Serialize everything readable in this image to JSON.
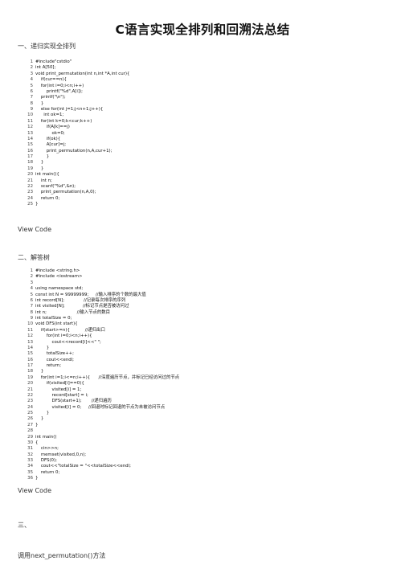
{
  "page": {
    "title": "C语言实现全排列和回溯法总结"
  },
  "sections": [
    {
      "heading": "一、递归实现全排列"
    },
    {
      "heading": "二、解答树"
    },
    {
      "heading": "三、"
    }
  ],
  "view_code_label": "View Code",
  "method_line": "调用next_permutation()方法",
  "code1": {
    "line_numbers": [
      "1",
      "2",
      "3",
      "4",
      "5",
      "6",
      "7",
      "8",
      "9",
      "10",
      "11",
      "12",
      "13",
      "14",
      "15",
      "16",
      "17",
      "18",
      "19",
      "20",
      "21",
      "22",
      "23",
      "24",
      "25"
    ],
    "lines": [
      "#include\"cstdio\"",
      "int A[50];",
      "void print_permutation(int n,int *A,int cur){",
      "    if(cur==n){",
      "    for(int i=0;i<n;i++)",
      "        printf(\"%d\",A[i]);",
      "    printf(\"\\n\");",
      "    }",
      "    else for(int j=1;j<n+1;j++){",
      "      int ok=1;",
      "    for(int k=0;k<cur;k++)",
      "        if(A[k]==j)",
      "            ok=0;",
      "        if(ok){",
      "        A[cur]=j;",
      "        print_permutation(n,A,cur+1);",
      "        }",
      "    }",
      "    }",
      "int main(){",
      "    int n;",
      "    scanf(\"%d\",&n);",
      "    print_permutation(n,A,0);",
      "    return 0;",
      "}"
    ]
  },
  "code2": {
    "line_numbers": [
      "1",
      "2",
      "3",
      "4",
      "5",
      "6",
      "7",
      "8",
      "9",
      "10",
      "11",
      "12",
      "13",
      "14",
      "15",
      "16",
      "17",
      "18",
      "19",
      "20",
      "21",
      "22",
      "23",
      "24",
      "25",
      "26",
      "27",
      "28",
      "29",
      "30",
      "31",
      "32",
      "33",
      "34",
      "35",
      "36"
    ],
    "lines": [
      "#include <string.h>",
      "#include <iostream>",
      "",
      "using namespace std;",
      "const int N = 99999999;     //输入排序的个数的最大值",
      "int record[N];              //记录每次排序的序列",
      "int visited[N];             //标记节点是否被访问过",
      "int n;                      //输入节点的数目",
      "int totalSize = 0;",
      "void DFS(int start){",
      "    if(start>=n){           //递归出口",
      "        for(int i=0;i<n;i++){",
      "            cout<<record[i]<<\" \";",
      "        }",
      "        totalSize++;",
      "        cout<<endl;",
      "        return;",
      "    }",
      "    for(int i=1;i<=n;i++){      //深度遍历节点，并标记已经访问过的节点",
      "        if(visited[i]==0){",
      "            visited[i] = 1;",
      "            record[start] = i;",
      "            DFS(start+1);       //递归遍历",
      "            visited[i] = 0;     //回退时标记回退的节点为未被访问节点",
      "        }",
      "    }",
      "}",
      "",
      "int main()",
      "{",
      "    cin>>n;",
      "    memset(visited,0,n);",
      "    DFS(0);",
      "    cout<<\"totalSize = \"<<totalSize<<endl;",
      "    return 0;",
      "}"
    ]
  }
}
